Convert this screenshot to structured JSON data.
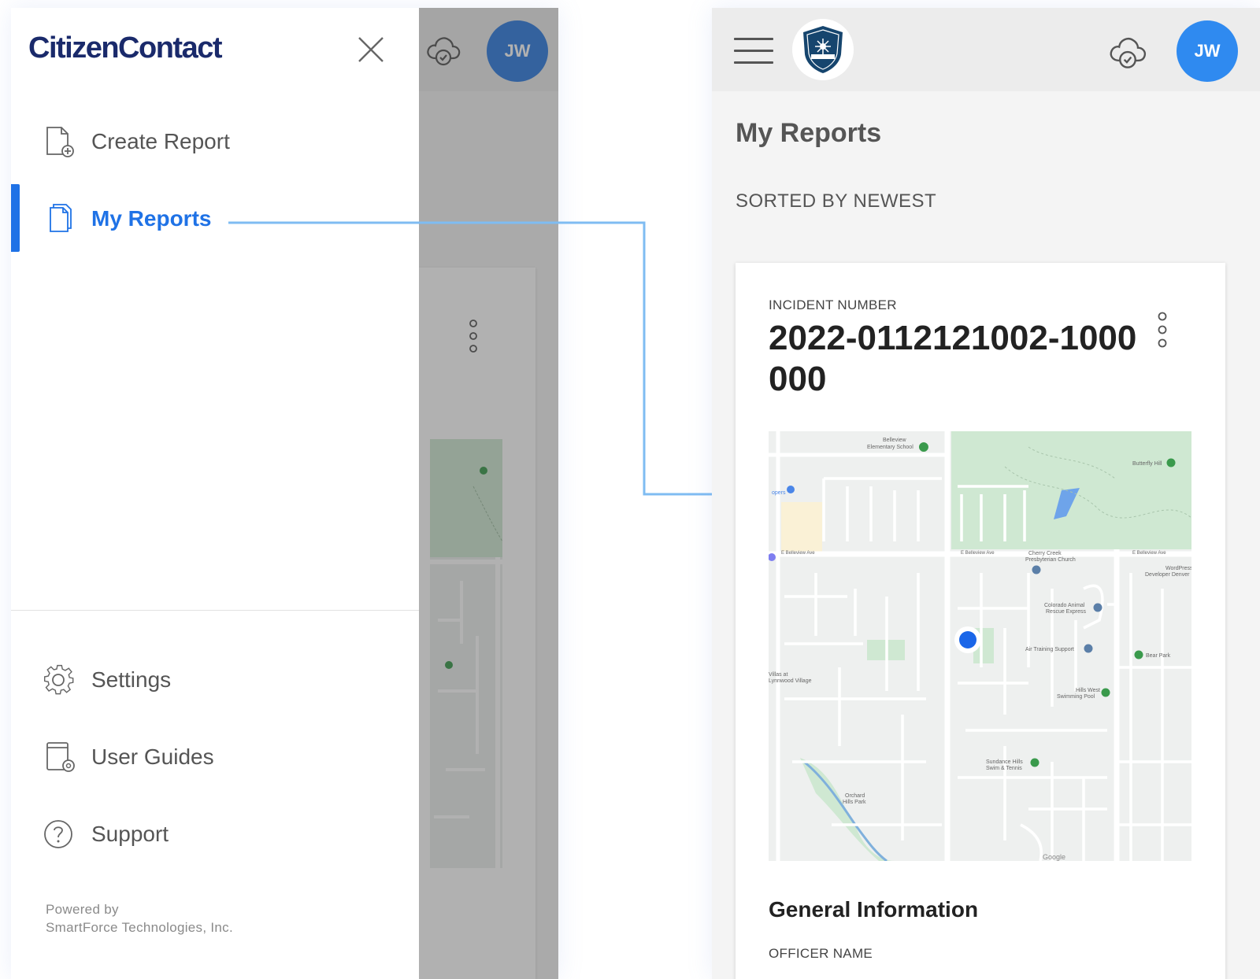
{
  "drawer": {
    "brand": "CitizenContact",
    "items": [
      {
        "label": "Create Report",
        "icon": "document-plus-icon",
        "active": false
      },
      {
        "label": "My Reports",
        "icon": "documents-icon",
        "active": true
      }
    ],
    "bottom_items": [
      {
        "label": "Settings",
        "icon": "gear-icon"
      },
      {
        "label": "User Guides",
        "icon": "guide-settings-icon"
      },
      {
        "label": "Support",
        "icon": "help-circle-icon"
      }
    ],
    "powered_by": "Powered by",
    "company": "SmartForce Technologies, Inc."
  },
  "header": {
    "avatar_initials": "JW",
    "logo_icon": "police-badge-icon",
    "sync_icon": "cloud-check-icon"
  },
  "main": {
    "title": "My Reports",
    "sort_label": "SORTED BY NEWEST",
    "card": {
      "incident_label": "INCIDENT NUMBER",
      "incident_number": "2022-0112121002-1000000",
      "section_title": "General Information",
      "field_label": "OFFICER NAME"
    }
  },
  "map": {
    "labels": {
      "elementary": "Belleview\nElementary School",
      "butterfly": "Butterfly Hill",
      "church": "Cherry Creek\nPresbyterian Church",
      "animal": "Colorado Animal\nRescue Express",
      "wordpress": "WordPress\nDeveloper Denver",
      "air": "Air Training Support",
      "bear": "Bear Park",
      "pool": "Hills West\nSwimming Pool",
      "sundance": "Sundance Hills\nSwim & Tennis",
      "orchard": "Orchard\nHills Park",
      "village": "Villas at\nLynnwood Village",
      "belleview_ave": "E Belleview Ave",
      "google": "Google"
    }
  },
  "colors": {
    "accent": "#1f72e6",
    "brand": "#1a2a6b",
    "avatar": "#2f8af0",
    "connector": "#7fbcf2"
  }
}
